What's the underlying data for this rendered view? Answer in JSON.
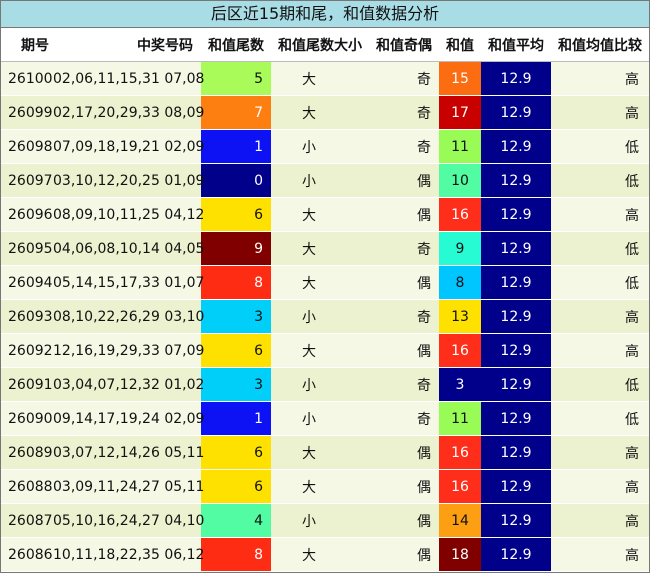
{
  "title": "后区近15期和尾，和值数据分析",
  "headers": {
    "issue": "期号",
    "numbers": "中奖号码",
    "tail": "和值尾数",
    "size": "和值尾数大小",
    "parity": "和值奇偶",
    "sum": "和值",
    "avg": "和值平均",
    "compare": "和值均值比较"
  },
  "colors": {
    "avg_bg": "#00008b",
    "row_odd": "#f6f8e6",
    "row_even": "#ecf2cf"
  },
  "rows": [
    {
      "issue": "26100",
      "numbers": "02,06,11,15,31 07,08",
      "tail": "5",
      "tail_bg": "#a8fb58",
      "tail_fg": "#111",
      "size": "大",
      "parity": "奇",
      "sum": "15",
      "sum_bg": "#fb6d10",
      "sum_fg": "#fff",
      "avg": "12.9",
      "compare": "高"
    },
    {
      "issue": "26099",
      "numbers": "02,17,20,29,33 08,09",
      "tail": "7",
      "tail_bg": "#fd7f11",
      "tail_fg": "#fff",
      "size": "大",
      "parity": "奇",
      "sum": "17",
      "sum_bg": "#c90000",
      "sum_fg": "#fff",
      "avg": "12.9",
      "compare": "高"
    },
    {
      "issue": "26098",
      "numbers": "07,09,18,19,21 02,09",
      "tail": "1",
      "tail_bg": "#0c12f4",
      "tail_fg": "#fff",
      "size": "小",
      "parity": "奇",
      "sum": "11",
      "sum_bg": "#98fb56",
      "sum_fg": "#111",
      "avg": "12.9",
      "compare": "低"
    },
    {
      "issue": "26097",
      "numbers": "03,10,12,20,25 01,09",
      "tail": "0",
      "tail_bg": "#00008b",
      "tail_fg": "#fff",
      "size": "小",
      "parity": "偶",
      "sum": "10",
      "sum_bg": "#52fca3",
      "sum_fg": "#111",
      "avg": "12.9",
      "compare": "低"
    },
    {
      "issue": "26096",
      "numbers": "08,09,10,11,25 04,12",
      "tail": "6",
      "tail_bg": "#ffe100",
      "tail_fg": "#111",
      "size": "大",
      "parity": "偶",
      "sum": "16",
      "sum_bg": "#ff2e1a",
      "sum_fg": "#fff",
      "avg": "12.9",
      "compare": "高"
    },
    {
      "issue": "26095",
      "numbers": "04,06,08,10,14 04,05",
      "tail": "9",
      "tail_bg": "#800000",
      "tail_fg": "#fff",
      "size": "大",
      "parity": "奇",
      "sum": "9",
      "sum_bg": "#27fbd4",
      "sum_fg": "#111",
      "avg": "12.9",
      "compare": "低"
    },
    {
      "issue": "26094",
      "numbers": "05,14,15,17,33 01,07",
      "tail": "8",
      "tail_bg": "#ff2c14",
      "tail_fg": "#fff",
      "size": "大",
      "parity": "偶",
      "sum": "8",
      "sum_bg": "#00c6ff",
      "sum_fg": "#111",
      "avg": "12.9",
      "compare": "低"
    },
    {
      "issue": "26093",
      "numbers": "08,10,22,26,29 03,10",
      "tail": "3",
      "tail_bg": "#00d0f9",
      "tail_fg": "#111",
      "size": "小",
      "parity": "奇",
      "sum": "13",
      "sum_bg": "#ffe100",
      "sum_fg": "#111",
      "avg": "12.9",
      "compare": "高"
    },
    {
      "issue": "26092",
      "numbers": "12,16,19,29,33 07,09",
      "tail": "6",
      "tail_bg": "#ffe100",
      "tail_fg": "#111",
      "size": "大",
      "parity": "偶",
      "sum": "16",
      "sum_bg": "#ff2e1a",
      "sum_fg": "#fff",
      "avg": "12.9",
      "compare": "高"
    },
    {
      "issue": "26091",
      "numbers": "03,04,07,12,32 01,02",
      "tail": "3",
      "tail_bg": "#00d0f9",
      "tail_fg": "#111",
      "size": "小",
      "parity": "奇",
      "sum": "3",
      "sum_bg": "#00008b",
      "sum_fg": "#fff",
      "avg": "12.9",
      "compare": "低"
    },
    {
      "issue": "26090",
      "numbers": "09,14,17,19,24 02,09",
      "tail": "1",
      "tail_bg": "#0c12f4",
      "tail_fg": "#fff",
      "size": "小",
      "parity": "奇",
      "sum": "11",
      "sum_bg": "#98fb56",
      "sum_fg": "#111",
      "avg": "12.9",
      "compare": "低"
    },
    {
      "issue": "26089",
      "numbers": "03,07,12,14,26 05,11",
      "tail": "6",
      "tail_bg": "#ffe100",
      "tail_fg": "#111",
      "size": "大",
      "parity": "偶",
      "sum": "16",
      "sum_bg": "#ff2e1a",
      "sum_fg": "#fff",
      "avg": "12.9",
      "compare": "高"
    },
    {
      "issue": "26088",
      "numbers": "03,09,11,24,27 05,11",
      "tail": "6",
      "tail_bg": "#ffe100",
      "tail_fg": "#111",
      "size": "大",
      "parity": "偶",
      "sum": "16",
      "sum_bg": "#ff2e1a",
      "sum_fg": "#fff",
      "avg": "12.9",
      "compare": "高"
    },
    {
      "issue": "26087",
      "numbers": "05,10,16,24,27 04,10",
      "tail": "4",
      "tail_bg": "#52fca3",
      "tail_fg": "#111",
      "size": "小",
      "parity": "偶",
      "sum": "14",
      "sum_bg": "#fd9f12",
      "sum_fg": "#111",
      "avg": "12.9",
      "compare": "高"
    },
    {
      "issue": "26086",
      "numbers": "10,11,18,22,35 06,12",
      "tail": "8",
      "tail_bg": "#ff2c14",
      "tail_fg": "#fff",
      "size": "大",
      "parity": "偶",
      "sum": "18",
      "sum_bg": "#800000",
      "sum_fg": "#fff",
      "avg": "12.9",
      "compare": "高"
    }
  ]
}
